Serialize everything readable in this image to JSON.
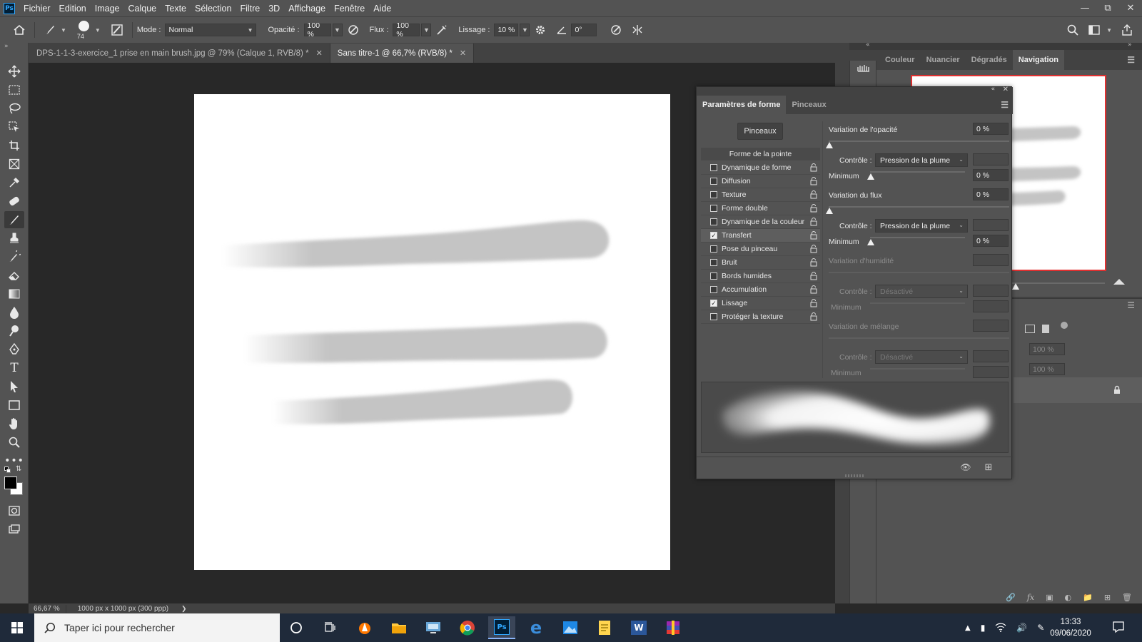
{
  "menubar": {
    "app_icon": "Ps",
    "items": [
      "Fichier",
      "Edition",
      "Image",
      "Calque",
      "Texte",
      "Sélection",
      "Filtre",
      "3D",
      "Affichage",
      "Fenêtre",
      "Aide"
    ],
    "window_controls": [
      "minimize-icon",
      "restore-icon",
      "close-icon"
    ]
  },
  "options": {
    "brush_size": "74",
    "mode_label": "Mode :",
    "mode_value": "Normal",
    "opacity_label": "Opacité :",
    "opacity_value": "100 %",
    "flow_label": "Flux :",
    "flow_value": "100 %",
    "smoothing_label": "Lissage :",
    "smoothing_value": "10 %",
    "angle_value": "0°"
  },
  "tabs": [
    {
      "label": "DPS-1-1-3-exercice_1 prise en main brush.jpg @ 79% (Calque 1, RVB/8) *",
      "active": false
    },
    {
      "label": "Sans titre-1 @ 66,7% (RVB/8) *",
      "active": true
    }
  ],
  "status": {
    "zoom": "66,67 %",
    "doc_size": "1000 px x 1000 px (300 ppp)",
    "arrow": "❯"
  },
  "right_panel": {
    "tabs": [
      "Couleur",
      "Nuancier",
      "Dégradés",
      "Navigation"
    ],
    "active_tab": "Navigation",
    "layer_opacity": "100 %",
    "layer_fill": "100 %"
  },
  "brush_panel": {
    "tabs": [
      "Paramètres de forme",
      "Pinceaux"
    ],
    "brushes_button": "Pinceaux",
    "list_header": "Forme de la pointe",
    "items": [
      {
        "label": "Dynamique de forme",
        "checked": false
      },
      {
        "label": "Diffusion",
        "checked": false
      },
      {
        "label": "Texture",
        "checked": false
      },
      {
        "label": "Forme double",
        "checked": false
      },
      {
        "label": "Dynamique de la couleur",
        "checked": false
      },
      {
        "label": "Transfert",
        "checked": true
      },
      {
        "label": "Pose du pinceau",
        "checked": false
      },
      {
        "label": "Bruit",
        "checked": false
      },
      {
        "label": "Bords humides",
        "checked": false
      },
      {
        "label": "Accumulation",
        "checked": false
      },
      {
        "label": "Lissage",
        "checked": true
      },
      {
        "label": "Protéger la texture",
        "checked": false
      }
    ],
    "opacity_variation_label": "Variation de l'opacité",
    "opacity_variation_value": "0 %",
    "control_label": "Contrôle :",
    "control_value": "Pression de la plume",
    "minimum_label": "Minimum",
    "minimum_value": "0 %",
    "flow_variation_label": "Variation du flux",
    "flow_variation_value": "0 %",
    "control2_value": "Pression de la plume",
    "minimum2_value": "0 %",
    "wet_variation_label": "Variation d'humidité",
    "control3_value": "Désactivé",
    "mix_variation_label": "Variation de mélange",
    "control4_value": "Désactivé"
  },
  "taskbar": {
    "search_placeholder": "Taper ici pour rechercher",
    "time": "13:33",
    "date": "09/06/2020"
  },
  "colors": {
    "ui_dark": "#535353",
    "ui_darker": "#424242",
    "canvas_bg": "#282828",
    "stroke_gray": "#c4c4c4",
    "nav_frame": "#e03030"
  }
}
